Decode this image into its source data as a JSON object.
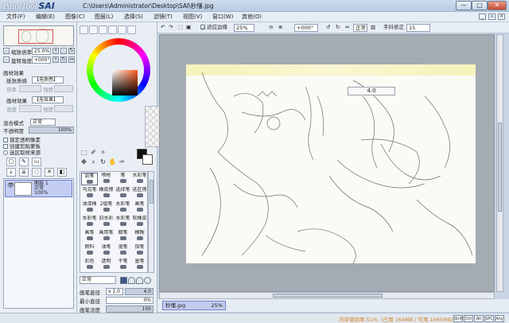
{
  "window": {
    "logo_script": "PaintTool",
    "logo_brand": "SAI",
    "title": "C:\\Users\\Administrator\\Desktop\\SAI\\秒懂.jpg",
    "minimize": "—",
    "maximize": "□",
    "close": "✕"
  },
  "menubar": {
    "items": [
      {
        "label": "文件(F)"
      },
      {
        "label": "编辑(E)"
      },
      {
        "label": "图像(C)"
      },
      {
        "label": "图层(L)"
      },
      {
        "label": "选择(S)"
      },
      {
        "label": "滤镜(T)"
      },
      {
        "label": "视图(V)"
      },
      {
        "label": "窗口(W)"
      },
      {
        "label": "其他(O)"
      }
    ]
  },
  "navigator": {
    "zoom_label": "缩放倍率",
    "zoom_value": "25.0%",
    "angle_label": "旋转角度",
    "angle_value": "+000°"
  },
  "paper_effects": {
    "header": "画材效果",
    "texture_label": "纸张质感",
    "texture_value": "【无质感】",
    "scale_label": "倍率",
    "scale_value": "100",
    "strength_label": "强度",
    "strength_value": "20",
    "effect_label": "画材效果",
    "effect_value": "【无效果】",
    "width_label": "宽度",
    "width_value": "1",
    "strength2_label": "强度",
    "strength2_value": "100"
  },
  "layer_props": {
    "blend_label": "混合模式",
    "blend_value": "正常",
    "opacity_label": "不透明度",
    "opacity_value": "100%",
    "lock_label": "锁定透明像素",
    "clip_label": "创建剪贴蒙板",
    "source_label": "选区取样来源"
  },
  "layers": [
    {
      "name": "图层 1",
      "mode": "正常",
      "opacity": "100%"
    }
  ],
  "color": {
    "hue_hex": "#ff5a1e",
    "foreground_hex": "#111111",
    "background_hex": "#ffffff"
  },
  "brush_tools": [
    {
      "label": "铅笔"
    },
    {
      "label": "喷枪"
    },
    {
      "label": "笔"
    },
    {
      "label": "水彩笔"
    },
    {
      "label": "马克笔"
    },
    {
      "label": "橡皮擦"
    },
    {
      "label": "选择笔"
    },
    {
      "label": "选区擦"
    },
    {
      "label": "油漆桶"
    },
    {
      "label": "2值笔"
    },
    {
      "label": "水彩笔"
    },
    {
      "label": "画笔"
    },
    {
      "label": "水彩笔"
    },
    {
      "label": "旧水彩"
    },
    {
      "label": "水彩笔"
    },
    {
      "label": "软橡皮"
    },
    {
      "label": "画笔"
    },
    {
      "label": "画用笔"
    },
    {
      "label": "蜡笔"
    },
    {
      "label": "模糊"
    },
    {
      "label": "颜料"
    },
    {
      "label": "油笔"
    },
    {
      "label": "漫笔"
    },
    {
      "label": "指笔"
    },
    {
      "label": "彩色"
    },
    {
      "label": "透明"
    },
    {
      "label": "干笔"
    },
    {
      "label": "墨笔"
    }
  ],
  "brush_settings": {
    "blend_value": "正常",
    "size_label": "画笔直径",
    "size_mult": "x 1.0",
    "size_value": "4.0",
    "min_label": "最小直径",
    "min_value": "0%",
    "density_label": "画笔浓度",
    "density_value": "100"
  },
  "toolbar": {
    "fit_label": "适应边缘",
    "zoom_value": "25%",
    "angle_value": "+000°",
    "mode_value": "正常",
    "stab_label": "手抖修正",
    "stab_value": "15"
  },
  "canvas": {
    "tooltip": "4.0"
  },
  "doc_tab": {
    "name": "秒懂.jpg",
    "zoom": "25%"
  },
  "status": {
    "memory": "内存使用率:51%（已用 164MB / 可用 1965MB）",
    "indicators": [
      "Shift",
      "Ctrl",
      "Alt",
      "SPC",
      "Any"
    ]
  }
}
